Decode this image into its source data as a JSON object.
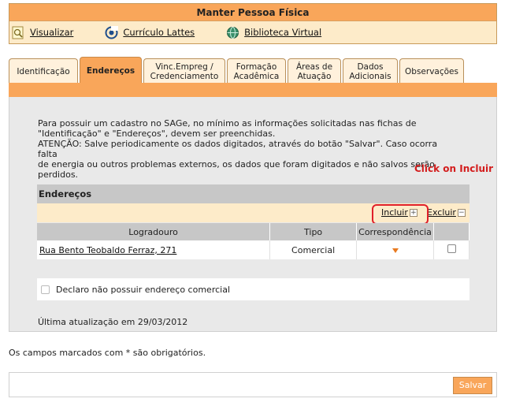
{
  "header": {
    "title": "Manter Pessoa Física",
    "toolbar": [
      {
        "label": "Visualizar",
        "icon": "magnifier-page-icon"
      },
      {
        "label": "Currículo Lattes",
        "icon": "lattes-logo-icon"
      },
      {
        "label": "Biblioteca Virtual",
        "icon": "globe-icon"
      }
    ]
  },
  "tabs": [
    {
      "line1": "Identificação",
      "line2": ""
    },
    {
      "line1": "Endereços",
      "line2": ""
    },
    {
      "line1": "Vinc.Empreg /",
      "line2": "Credenciamento"
    },
    {
      "line1": "Formação",
      "line2": "Acadêmica"
    },
    {
      "line1": "Áreas de",
      "line2": "Atuação"
    },
    {
      "line1": "Dados",
      "line2": "Adicionais"
    },
    {
      "line1": "Observações",
      "line2": ""
    }
  ],
  "active_tab": "Endereços",
  "info": {
    "line1": "Para possuir um cadastro no SAGe, no mínimo as informações solicitadas nas fichas de",
    "line2": "\"Identificação\" e \"Endereços\", devem ser preenchidas.",
    "line3": "ATENÇÃO: Salve periodicamente os dados digitados, através do botão \"Salvar\". Caso ocorra falta",
    "line4": "de energia ou outros problemas externos, os dados que foram digitados e não salvos serão",
    "line5": "perdidos."
  },
  "annotation": "Click on Incluir",
  "addresses": {
    "section_title": "Endereços",
    "include_label": "Incluir",
    "exclude_label": "Excluir",
    "plus_symbol": "+",
    "minus_symbol": "−",
    "columns": [
      "Logradouro",
      "Tipo",
      "Correspondência",
      ""
    ],
    "rows": [
      {
        "logradouro": "Rua Bento Teobaldo Ferraz, 271",
        "tipo": "Comercial",
        "correspondencia": true,
        "selected": false
      }
    ]
  },
  "declare_label": "Declaro não possuir endereço comercial",
  "last_update": "Última atualização em 29/03/2012",
  "required_note": "Os campos marcados com * são obrigatórios.",
  "save_label": "Salvar",
  "colors": {
    "accent": "#f9a65a",
    "header_bg": "#fdebc9",
    "annotation": "#d31d1d"
  }
}
